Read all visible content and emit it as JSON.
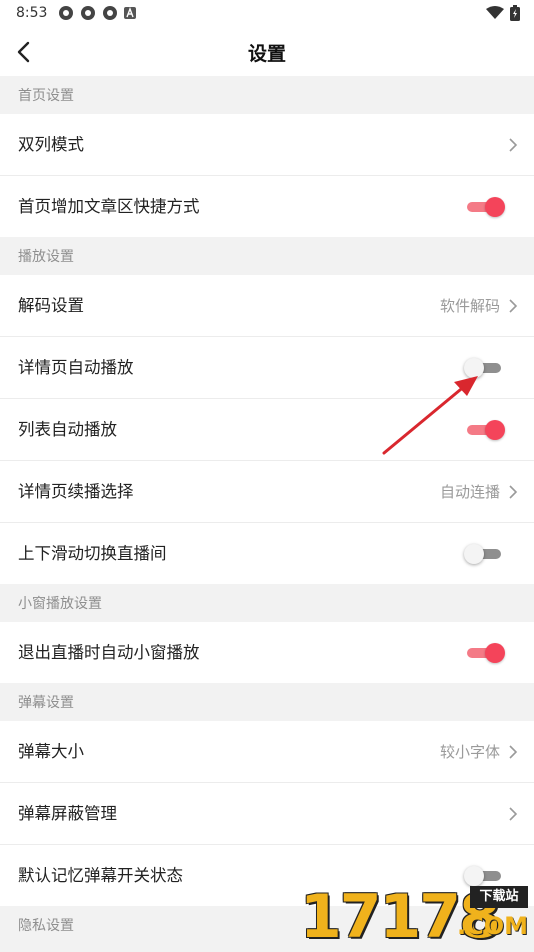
{
  "status_bar": {
    "time": "8:53"
  },
  "header": {
    "title": "设置"
  },
  "sections": [
    {
      "title": "首页设置",
      "items": [
        {
          "label": "双列模式",
          "type": "link"
        },
        {
          "label": "首页增加文章区快捷方式",
          "type": "toggle",
          "on": true
        }
      ]
    },
    {
      "title": "播放设置",
      "items": [
        {
          "label": "解码设置",
          "type": "link",
          "value": "软件解码"
        },
        {
          "label": "详情页自动播放",
          "type": "toggle",
          "on": false
        },
        {
          "label": "列表自动播放",
          "type": "toggle",
          "on": true
        },
        {
          "label": "详情页续播选择",
          "type": "link",
          "value": "自动连播"
        },
        {
          "label": "上下滑动切换直播间",
          "type": "toggle",
          "on": false
        }
      ]
    },
    {
      "title": "小窗播放设置",
      "items": [
        {
          "label": "退出直播时自动小窗播放",
          "type": "toggle",
          "on": true
        }
      ]
    },
    {
      "title": "弹幕设置",
      "items": [
        {
          "label": "弹幕大小",
          "type": "link",
          "value": "较小字体"
        },
        {
          "label": "弹幕屏蔽管理",
          "type": "link"
        },
        {
          "label": "默认记忆弹幕开关状态",
          "type": "toggle",
          "on": false
        }
      ]
    },
    {
      "title": "隐私设置",
      "items": []
    }
  ],
  "watermark": {
    "number": "17178",
    "badge": "下载站",
    "suffix": ".COM"
  },
  "colors": {
    "accent": "#f4445a",
    "annotation_arrow": "#d9272e"
  }
}
